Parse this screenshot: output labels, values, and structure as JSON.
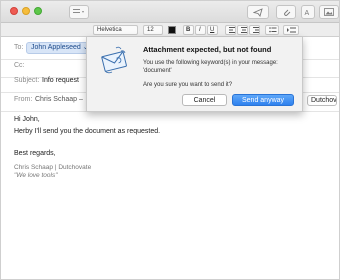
{
  "toolbar": {
    "buttons": [
      {
        "icon": "send-icon"
      },
      {
        "icon": "attachment-icon"
      },
      {
        "icon": "format-icon"
      },
      {
        "icon": "photo-icon"
      }
    ]
  },
  "format_bar": {
    "font": "Helvetica",
    "size": "12",
    "color": "#111111",
    "bold": "B",
    "italic": "I",
    "underline": "U"
  },
  "header": {
    "to_label": "To:",
    "to_recipient": "John Appleseed",
    "cc_label": "Cc:",
    "subject_label": "Subject:",
    "subject_value": "Info request",
    "from_label": "From:",
    "from_value": "Chris Schaap –",
    "from_account": "Dutchov"
  },
  "body": {
    "greeting": "Hi John,",
    "line1": "Herby I'll send you the document as requested.",
    "closing": "Best regards,",
    "sig_name": "Chris Schaap | Dutchovate",
    "sig_tagline": "\"We love tools\""
  },
  "dialog": {
    "title": "Attachment expected, but not found",
    "message": "You use the following keyword(s) in your message: 'document'",
    "question": "Are you sure you want to send it?",
    "cancel_label": "Cancel",
    "send_label": "Send anyway",
    "accent": "#2f81ee"
  }
}
